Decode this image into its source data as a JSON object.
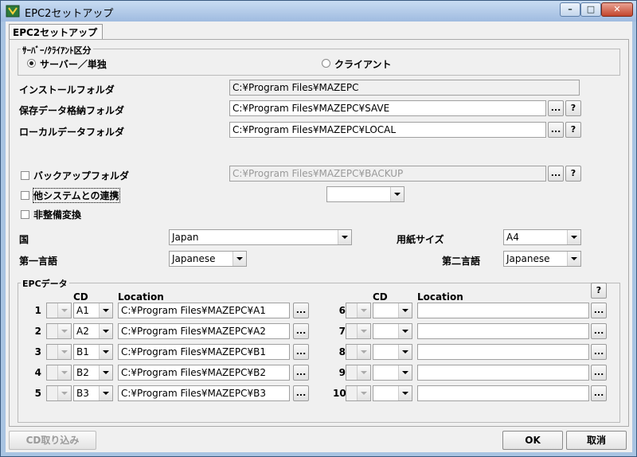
{
  "window": {
    "title": "EPC2セットアップ"
  },
  "tab": {
    "label": "EPC2セットアップ"
  },
  "mode_group": {
    "label": "ｻｰﾊﾞｰ/ｸﾗｲｱﾝﾄ区分",
    "option_server": "サーバー／単独",
    "option_client": "クライアント",
    "selected": "server"
  },
  "folders": {
    "install": {
      "label": "インストールフォルダ",
      "value": "C:¥Program Files¥MAZEPC"
    },
    "save": {
      "label": "保存データ格納フォルダ",
      "value": "C:¥Program Files¥MAZEPC¥SAVE"
    },
    "local": {
      "label": "ローカルデータフォルダ",
      "value": "C:¥Program Files¥MAZEPC¥LOCAL"
    },
    "backup": {
      "label": "バックアップフォルダ",
      "value": "C:¥Program Files¥MAZEPC¥BACKUP"
    },
    "browse": "...",
    "help": "?"
  },
  "options": {
    "other_system": "他システムとの連携",
    "non_maintenance": "非整備変換"
  },
  "locale": {
    "country_label": "国",
    "country_value": "Japan",
    "paper_label": "用紙サイズ",
    "paper_value": "A4",
    "lang1_label": "第一言語",
    "lang1_value": "Japanese",
    "lang2_label": "第二言語",
    "lang2_value": "Japanese"
  },
  "epc_group": {
    "label": "EPCデータ",
    "cd_header": "CD",
    "location_header": "Location",
    "help": "?",
    "browse": "...",
    "left_rows": [
      {
        "num": "1",
        "cd": "A1",
        "location": "C:¥Program Files¥MAZEPC¥A1"
      },
      {
        "num": "2",
        "cd": "A2",
        "location": "C:¥Program Files¥MAZEPC¥A2"
      },
      {
        "num": "3",
        "cd": "B1",
        "location": "C:¥Program Files¥MAZEPC¥B1"
      },
      {
        "num": "4",
        "cd": "B2",
        "location": "C:¥Program Files¥MAZEPC¥B2"
      },
      {
        "num": "5",
        "cd": "B3",
        "location": "C:¥Program Files¥MAZEPC¥B3"
      }
    ],
    "right_rows": [
      {
        "num": "6",
        "cd": "",
        "location": ""
      },
      {
        "num": "7",
        "cd": "",
        "location": ""
      },
      {
        "num": "8",
        "cd": "",
        "location": ""
      },
      {
        "num": "9",
        "cd": "",
        "location": ""
      },
      {
        "num": "10",
        "cd": "",
        "location": ""
      }
    ]
  },
  "footer": {
    "cd_import": "CD取り込み",
    "ok": "OK",
    "cancel": "取消"
  }
}
